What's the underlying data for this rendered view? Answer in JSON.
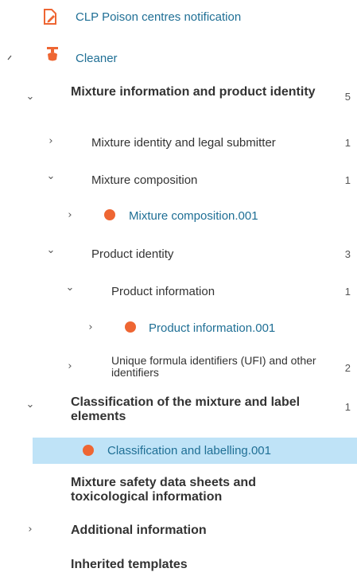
{
  "colors": {
    "accent": "#ee6633",
    "link": "#1f6f95",
    "selected_bg": "#bfe3f7"
  },
  "tree": {
    "root": {
      "label": "CLP Poison centres notification",
      "icon": "edit-document-icon"
    },
    "dossier": {
      "label": "Cleaner",
      "icon": "spray-bottle-icon"
    },
    "n1": {
      "label": "Mixture information and product identity",
      "count": "5"
    },
    "n1a": {
      "label": "Mixture identity and legal submitter",
      "count": "1"
    },
    "n1b": {
      "label": "Mixture composition",
      "count": "1"
    },
    "n1b1": {
      "label": "Mixture composition.001"
    },
    "n1c": {
      "label": "Product identity",
      "count": "3"
    },
    "n1c1": {
      "label": "Product information",
      "count": "1"
    },
    "n1c1a": {
      "label": "Product information.001"
    },
    "n1c2": {
      "label": "Unique formula identifiers (UFI) and other identifiers",
      "count": "2"
    },
    "n2": {
      "label": "Classification of the mixture and label elements",
      "count": "1"
    },
    "n2a": {
      "label": "Classification and labelling.001"
    },
    "n3": {
      "label": "Mixture safety data sheets and toxicological information"
    },
    "n4": {
      "label": "Additional information"
    },
    "n5": {
      "label": "Inherited templates"
    }
  }
}
